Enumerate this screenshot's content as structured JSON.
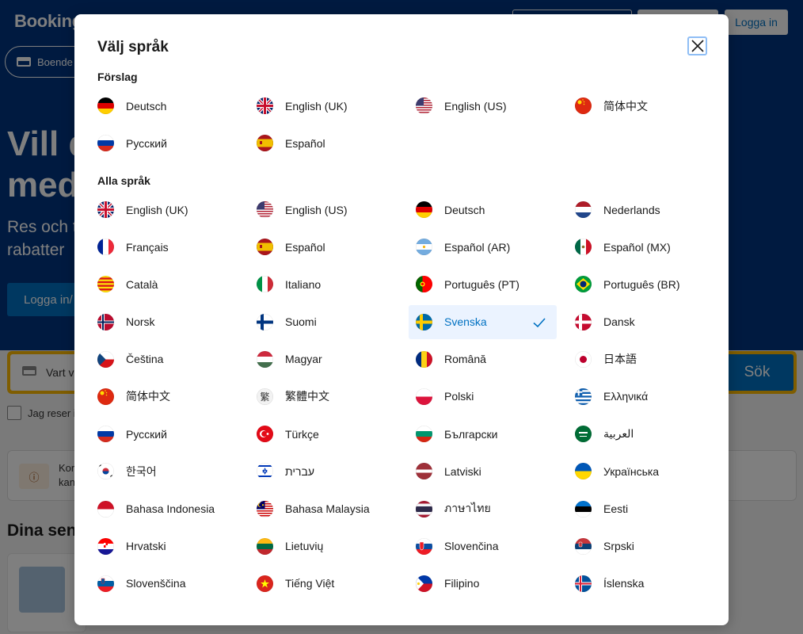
{
  "background": {
    "logo": "Booking",
    "login_top": "Logga in",
    "tab": "Boende",
    "hero_line1": "Vill d",
    "hero_line2": "med",
    "sub_line1": "Res och t",
    "sub_line2": "rabatter",
    "login_btn": "Logga in/",
    "search_placeholder": "Vart vi",
    "search_button": "Sök",
    "checkbox_label": "Jag reser i",
    "info_text_1": "Kor",
    "info_text_2": "kan",
    "recent_title": "Dina sen"
  },
  "modal": {
    "title": "Välj språk",
    "suggestions_title": "Förslag",
    "all_title": "Alla språk",
    "suggestions": [
      {
        "name": "Deutsch",
        "flag": "de"
      },
      {
        "name": "English (UK)",
        "flag": "gb"
      },
      {
        "name": "English (US)",
        "flag": "us"
      },
      {
        "name": "简体中文",
        "flag": "cn"
      },
      {
        "name": "Русский",
        "flag": "ru"
      },
      {
        "name": "Español",
        "flag": "es"
      }
    ],
    "languages": [
      {
        "name": "English (UK)",
        "flag": "gb"
      },
      {
        "name": "English (US)",
        "flag": "us"
      },
      {
        "name": "Deutsch",
        "flag": "de"
      },
      {
        "name": "Nederlands",
        "flag": "nl"
      },
      {
        "name": "Français",
        "flag": "fr"
      },
      {
        "name": "Español",
        "flag": "es"
      },
      {
        "name": "Español (AR)",
        "flag": "ar"
      },
      {
        "name": "Español (MX)",
        "flag": "mx"
      },
      {
        "name": "Català",
        "flag": "cat"
      },
      {
        "name": "Italiano",
        "flag": "it"
      },
      {
        "name": "Português (PT)",
        "flag": "pt"
      },
      {
        "name": "Português (BR)",
        "flag": "br"
      },
      {
        "name": "Norsk",
        "flag": "no"
      },
      {
        "name": "Suomi",
        "flag": "fi"
      },
      {
        "name": "Svenska",
        "flag": "se",
        "selected": true
      },
      {
        "name": "Dansk",
        "flag": "dk"
      },
      {
        "name": "Čeština",
        "flag": "cz"
      },
      {
        "name": "Magyar",
        "flag": "hu"
      },
      {
        "name": "Română",
        "flag": "ro"
      },
      {
        "name": "日本語",
        "flag": "jp"
      },
      {
        "name": "简体中文",
        "flag": "cn"
      },
      {
        "name": "繁體中文",
        "flag": "tw"
      },
      {
        "name": "Polski",
        "flag": "pl"
      },
      {
        "name": "Ελληνικά",
        "flag": "gr"
      },
      {
        "name": "Русский",
        "flag": "ru"
      },
      {
        "name": "Türkçe",
        "flag": "tr"
      },
      {
        "name": "Български",
        "flag": "bg"
      },
      {
        "name": "العربية",
        "flag": "sa"
      },
      {
        "name": "한국어",
        "flag": "kr"
      },
      {
        "name": "עברית",
        "flag": "il"
      },
      {
        "name": "Latviski",
        "flag": "lv"
      },
      {
        "name": "Українська",
        "flag": "ua"
      },
      {
        "name": "Bahasa Indonesia",
        "flag": "id"
      },
      {
        "name": "Bahasa Malaysia",
        "flag": "my"
      },
      {
        "name": "ภาษาไทย",
        "flag": "th"
      },
      {
        "name": "Eesti",
        "flag": "ee"
      },
      {
        "name": "Hrvatski",
        "flag": "hr"
      },
      {
        "name": "Lietuvių",
        "flag": "lt"
      },
      {
        "name": "Slovenčina",
        "flag": "sk"
      },
      {
        "name": "Srpski",
        "flag": "rs"
      },
      {
        "name": "Slovenščina",
        "flag": "si"
      },
      {
        "name": "Tiếng Việt",
        "flag": "vn"
      },
      {
        "name": "Filipino",
        "flag": "ph"
      },
      {
        "name": "Íslenska",
        "flag": "is"
      }
    ]
  },
  "colors": {
    "brand_blue": "#003580",
    "action_blue": "#0071c2",
    "search_yellow": "#febb02",
    "selected_bg": "#ebf3ff"
  }
}
